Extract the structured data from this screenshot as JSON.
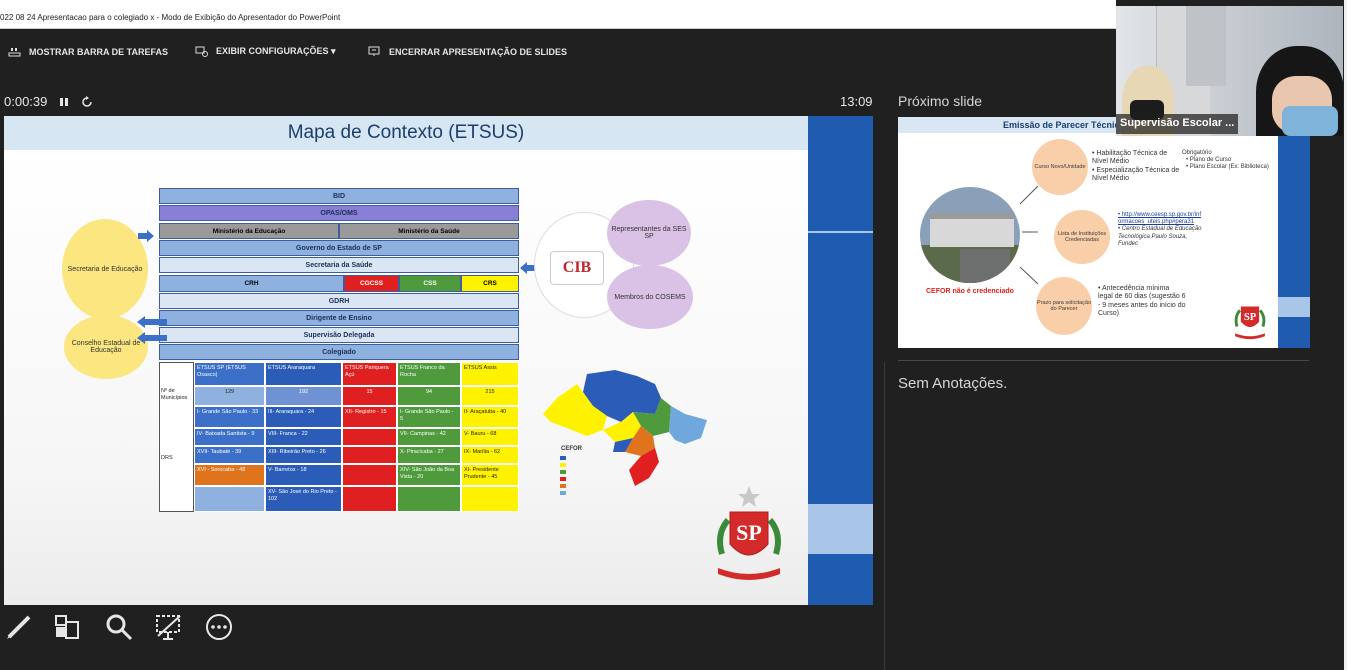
{
  "window": {
    "title": "022 08 24 Apresentacao para o colegiado x - Modo de Exibição do Apresentador do PowerPoint"
  },
  "toolbar": {
    "taskbar_label": "MOSTRAR BARRA DE TAREFAS",
    "display_label": "EXIBIR CONFIGURAÇÕES ▾",
    "end_label": "ENCERRAR APRESENTAÇÃO DE SLIDES"
  },
  "timer": {
    "elapsed": "0:00:39",
    "clock": "13:09",
    "pause_icon": "pause-icon",
    "restart_icon": "restart-icon"
  },
  "next": {
    "label": "Próximo slide"
  },
  "notes": {
    "text": "Sem Anotações."
  },
  "webcam": {
    "participant": "Supervisão Escolar ..."
  },
  "colors": {
    "background": "#202020",
    "slide_blue": "#1f5cb0",
    "slide_pale_blue": "#a9c6e8",
    "table_blue": "#8fb1df",
    "table_violet": "#8a7fd6",
    "grey": "#9a9a9a",
    "red": "#e02020",
    "green": "#4e9a3c",
    "yellow": "#fff200",
    "orange": "#e0741c",
    "oval_yellow": "#fbe680",
    "oval_lilac": "#d9c2e6",
    "peach": "#f9cfa9"
  },
  "main_slide": {
    "title": "Mapa de Contexto (ETSUS)",
    "rows": {
      "bid": "BID",
      "opas": "OPAS/OMS",
      "min_edu": "Ministério da Educação",
      "min_saude": "Ministério da Saúde",
      "governo": "Governo do Estado de SP",
      "secretaria": "Secretaria da Saúde",
      "crh": "CRH",
      "cgcss": "CGCSS",
      "css": "CSS",
      "crs": "CRS",
      "gdrh": "GDRH",
      "dirigente": "Dirigente de Ensino",
      "supervisao": "Supervisão Delegada",
      "colegiado": "Colegiado"
    },
    "ovals": {
      "sec_educacao": "Secretaria de Educação",
      "conselho": "Conselho Estadual de Educação",
      "representantes": "Representantes da SES SP",
      "membros": "Membros do COSEMS",
      "cib": "CIB"
    },
    "grid": {
      "headers": [
        "ETSUS SP (ETSUS Osasco)",
        "ETSUS Araraquara",
        "ETSUS Pariquera Açú",
        "ETSUS Franco da Rocha",
        "ETSUS Assis"
      ],
      "row_label_municipios": "Nº de Municípios",
      "municipios": [
        "129",
        "192",
        "15",
        "94",
        "215"
      ],
      "row_label_drs": "DRS",
      "drs": [
        [
          "I- Grande São Paulo - 33",
          "III- Araraquara - 24",
          "XII- Registro - 15",
          "I- Grande São Paulo - 5",
          "II- Araçatuba - 40"
        ],
        [
          "IV- Baixada Santista - 9",
          "VIII- Franca - 22",
          "",
          "VII- Campinas - 42",
          "V- Bauru - 68"
        ],
        [
          "XVII- Taubaté - 39",
          "XIII- Ribeirão Preto - 26",
          "",
          "X- Piracicaba - 27",
          "IX- Marília - 62"
        ],
        [
          "XVI - Sorocaba - 48",
          "V- Barretos - 18",
          "",
          "XIV- São João da Boa Vista - 20",
          "XI- Presidente Prudente - 45"
        ],
        [
          "",
          "XV- São José do Rio Preto - 102",
          "",
          "",
          ""
        ]
      ]
    },
    "map_legend_title": "CEFOR"
  },
  "next_slide": {
    "title": "Emissão de Parecer Técnico",
    "circles": {
      "curso": "Curso Novo/Unidade",
      "lista": "Lista de Instituições Credenciadas",
      "prazo": "Prazo para solicitação do Parecer"
    },
    "bullets_curso": [
      "Habilitação Técnica de Nível Médio",
      "Especialização Técnica de Nível Médio"
    ],
    "obrigatorio": "Obrigatório",
    "obrigatorio_items": [
      "Plano de Curso",
      "Plano Escolar (Ex: Biblioteca)"
    ],
    "lista_items": [
      "http://www.ceesp.sp.gov.br/informacoes_uteis.php#pera31",
      "Centro Estadual de Educação Tecnológica Paulo Souza, Fundec"
    ],
    "prazo_item": "Antecedência mínima legal de 60 dias (sugestão 6 - 9 meses antes do início do Curso)",
    "cefor": "CEFOR não é credenciado"
  },
  "bottom_tools": [
    "pen-icon",
    "slides-grid-icon",
    "zoom-icon",
    "screen-black-icon",
    "more-options-icon"
  ]
}
